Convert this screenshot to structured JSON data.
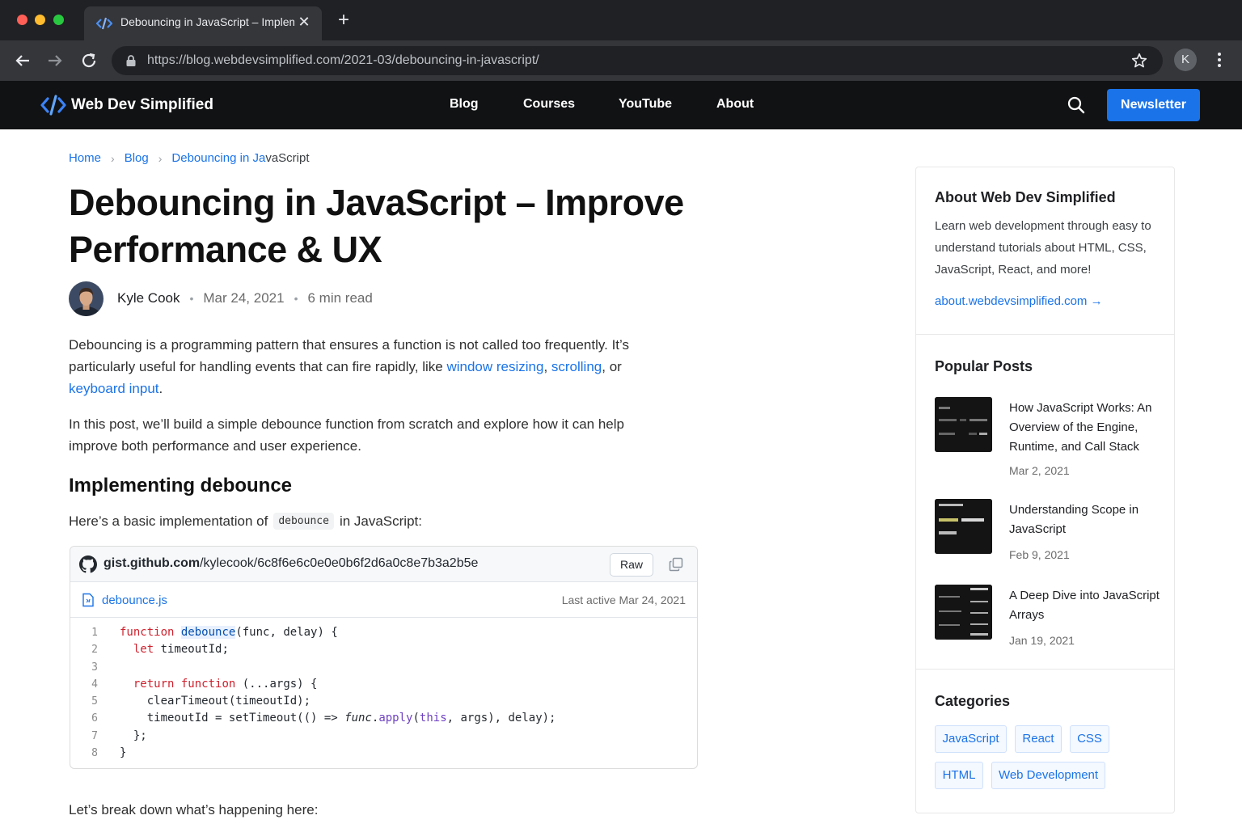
{
  "browser": {
    "tab_title": "Debouncing in JavaScript – Impleme",
    "url": "https://blog.webdevsimplified.com/2021-03/debouncing-in-javascript/",
    "profile_initial": "K"
  },
  "site": {
    "brand": "Web Dev Simplified",
    "nav": [
      "Blog",
      "Courses",
      "YouTube",
      "About"
    ],
    "newsletter": "Newsletter"
  },
  "breadcrumb": {
    "home": "Home",
    "blog": "Blog",
    "current_link_part": "Debouncing in Ja",
    "current_rest": "vaScript"
  },
  "article": {
    "title": "Debouncing in JavaScript – Improve Performance & UX",
    "author": "Kyle Cook",
    "date": "Mar 24, 2021",
    "read_time": "6 min read",
    "p1_a": "Debouncing is a programming pattern that ensures a function is not called too frequently. It’s particularly useful for handling events that can fire rapidly, like ",
    "p1_link1": "window resizing",
    "p1_sep": ", ",
    "p1_link2": "scrolling",
    "p1_b": ", or ",
    "p1_link3": "keyboard input",
    "p1_end": ".",
    "p2": "In this post, we’ll build a simple debounce function from scratch and explore how it can help improve both performance and user experience.",
    "h2": "Implementing debounce",
    "p3_a": "Here’s a basic implementation of",
    "p3_code": "debounce",
    "p3_b": "in JavaScript:",
    "p4": "Let’s break down what’s happening here:"
  },
  "gist": {
    "url_bold": "gist.github.com",
    "url_rest": "/kylecook/6c8f6e6c0e0e0b6f2d6a0c8e7b3a2b5e",
    "raw": "Raw",
    "file_name": "debounce.js",
    "last_active": "Last active Mar 24, 2021",
    "line_numbers": [
      "1",
      "2",
      "3",
      "4",
      "5",
      "6",
      "7",
      "8"
    ]
  },
  "sidebar": {
    "about_heading": "About Web Dev Simplified",
    "about_text": "Learn web development through easy to understand tutorials about HTML, CSS, JavaScript, React, and more!",
    "about_link": "about.webdevsimplified.com →",
    "popular_heading": "Popular Posts",
    "posts": [
      {
        "title": "How JavaScript Works: An Overview of the Engine, Runtime, and Call Stack",
        "date": "Mar 2, 2021"
      },
      {
        "title": "Understanding Scope in JavaScript",
        "date": "Feb 9, 2021"
      },
      {
        "title": "A Deep Dive into JavaScript Arrays",
        "date": "Jan 19, 2021"
      }
    ],
    "categories_heading": "Categories",
    "categories": [
      "JavaScript",
      "React",
      "CSS",
      "HTML",
      "Web Development"
    ]
  },
  "colors": {
    "accent": "#1a73e8",
    "header_bg": "#111214",
    "chrome_bg": "#202124"
  },
  "icons": [
    "code-brackets-icon",
    "close-icon",
    "plus-icon",
    "back-arrow-icon",
    "forward-arrow-icon",
    "reload-icon",
    "lock-icon",
    "star-icon",
    "kebab-menu-icon",
    "search-icon",
    "github-icon",
    "copy-icon",
    "file-icon",
    "chevron-right-icon",
    "arrow-right-icon"
  ]
}
